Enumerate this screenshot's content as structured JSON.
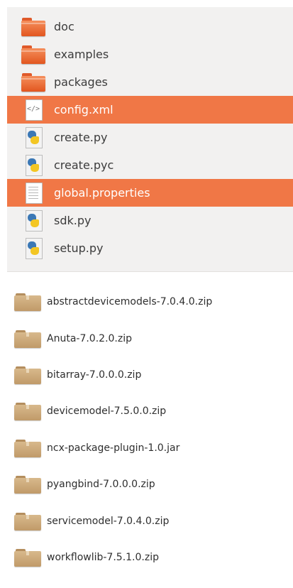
{
  "file_list": {
    "items": [
      {
        "name": "doc",
        "icon": "folder-icon",
        "selected": false
      },
      {
        "name": "examples",
        "icon": "folder-icon",
        "selected": false
      },
      {
        "name": "packages",
        "icon": "folder-icon",
        "selected": false
      },
      {
        "name": "config.xml",
        "icon": "xml-file-icon",
        "selected": true
      },
      {
        "name": "create.py",
        "icon": "python-file-icon",
        "selected": false
      },
      {
        "name": "create.pyc",
        "icon": "python-file-icon",
        "selected": false
      },
      {
        "name": "global.properties",
        "icon": "text-file-icon",
        "selected": true
      },
      {
        "name": "sdk.py",
        "icon": "python-file-icon",
        "selected": false
      },
      {
        "name": "setup.py",
        "icon": "python-file-icon",
        "selected": false
      }
    ]
  },
  "archive_list": {
    "items": [
      {
        "name": "abstractdevicemodels-7.0.4.0.zip",
        "icon": "archive-folder-icon"
      },
      {
        "name": "Anuta-7.0.2.0.zip",
        "icon": "archive-folder-icon"
      },
      {
        "name": "bitarray-7.0.0.0.zip",
        "icon": "archive-folder-icon"
      },
      {
        "name": "devicemodel-7.5.0.0.zip",
        "icon": "archive-folder-icon"
      },
      {
        "name": "ncx-package-plugin-1.0.jar",
        "icon": "archive-folder-icon"
      },
      {
        "name": "pyangbind-7.0.0.0.zip",
        "icon": "archive-folder-icon"
      },
      {
        "name": "servicemodel-7.0.4.0.zip",
        "icon": "archive-folder-icon"
      },
      {
        "name": "workflowlib-7.5.1.0.zip",
        "icon": "archive-folder-icon"
      }
    ]
  },
  "colors": {
    "selection": "#f07746",
    "panel_background": "#f2f1f0",
    "folder_orange": "#e86a34",
    "folder_tan": "#c9a474"
  }
}
